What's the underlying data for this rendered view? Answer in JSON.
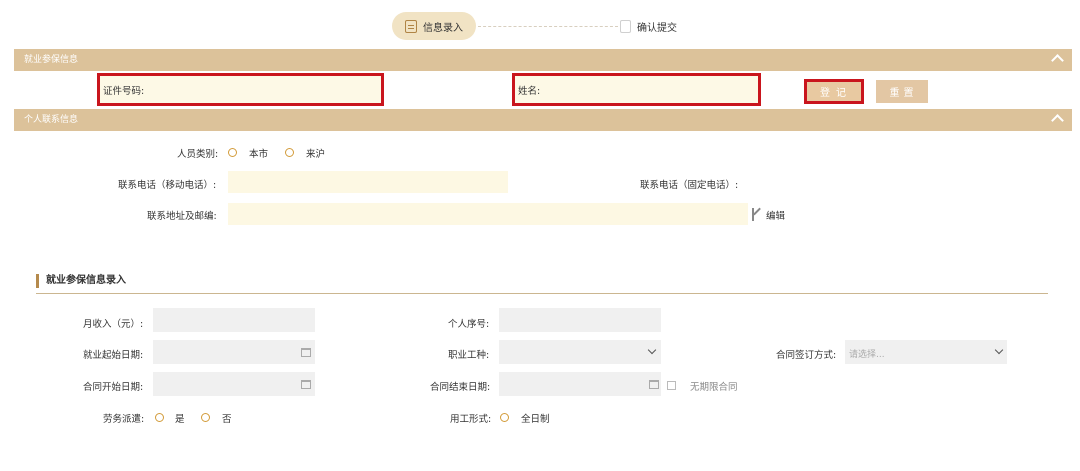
{
  "steps": {
    "step1": "信息录入",
    "step2": "确认提交"
  },
  "watermark": "",
  "section1": {
    "title": "就业参保信息",
    "id_label": "证件号码:",
    "id_value": "",
    "name_label": "姓名:",
    "name_value": "",
    "login_button": "登记",
    "reset_button": "重置"
  },
  "section2": {
    "title": "个人联系信息",
    "category_label": "人员类别:",
    "category_options": [
      "本市",
      "来沪"
    ],
    "mobile_label": "联系电话（移动电话）:",
    "fixed_label": "联系电话（固定电话）:",
    "address_label": "联系地址及邮编:",
    "edit_label": "编辑"
  },
  "section3": {
    "title": "就业参保信息录入",
    "income_label": "月收入（元）:",
    "personal_no_label": "个人序号:",
    "start_date_label": "就业起始日期:",
    "occupation_label": "职业工种:",
    "contract_sign_label": "合同签订方式:",
    "contract_sign_placeholder": "请选择...",
    "contract_start_label": "合同开始日期:",
    "contract_end_label": "合同结束日期:",
    "unlimited_label": "无期限合同",
    "dispatch_label": "劳务派遣:",
    "dispatch_options": [
      "是",
      "否"
    ],
    "employment_form_label": "用工形式:",
    "employment_form_option": "全日制"
  },
  "colors": {
    "accent": "#dcc29a",
    "highlight": "#c9151d",
    "radio": "#d39c3b"
  }
}
